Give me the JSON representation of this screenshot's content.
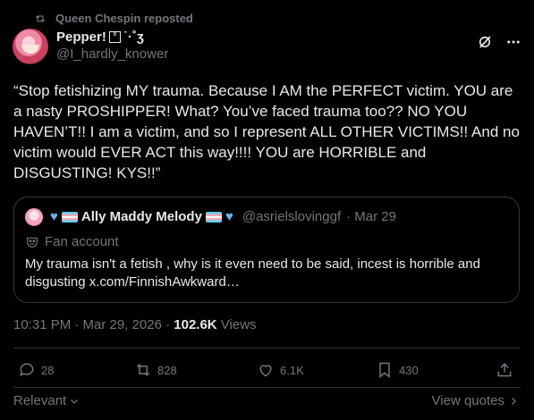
{
  "repost": {
    "text": "Queen Chespin reposted"
  },
  "author": {
    "display_name": "Pepper!",
    "name_suffix": "˙·˚ʒ",
    "handle": "@I_hardly_knower"
  },
  "tweet": {
    "text": "“Stop fetishizing MY trauma. Because I AM the PERFECT victim. YOU are a nasty PROSHIPPER! What? You’ve faced trauma too?? NO YOU HAVEN’T!! I am a victim, and so I represent ALL OTHER VICTIMS!! And no victim would EVER ACT this way!!!! YOU are HORRIBLE and DISGUSTING! KYS!!”"
  },
  "quote": {
    "display_name": "Ally Maddy Melody",
    "handle": "@asrielslovinggf",
    "date": "· Mar 29",
    "label": "Fan account",
    "text": "My trauma isn't a fetish , why is it even need to be said, incest is horrible and disgusting x.com/FinnishAwkward…"
  },
  "meta": {
    "time": "10:31 PM · Mar 29, 2026 · ",
    "views_count": "102.6K",
    "views_label": " Views"
  },
  "actions": {
    "replies": "28",
    "reposts": "828",
    "likes": "6.1K",
    "bookmarks": "430"
  },
  "footer": {
    "relevant": "Relevant",
    "view_quotes": "View quotes"
  },
  "colors": {
    "background": "#000000",
    "text": "#e7e9ea",
    "muted": "#71767b",
    "border": "#2f3336"
  }
}
